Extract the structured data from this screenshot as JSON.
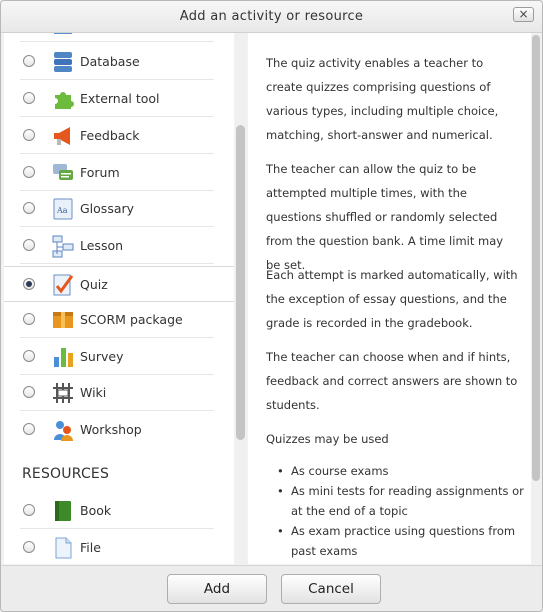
{
  "dialog": {
    "title": "Add an activity or resource",
    "close_glyph": "×"
  },
  "activities": {
    "selected_index": 6,
    "items": [
      {
        "label": "",
        "icon": "partial-icon"
      },
      {
        "label": "Database",
        "icon": "database-icon"
      },
      {
        "label": "External tool",
        "icon": "puzzle-icon"
      },
      {
        "label": "Feedback",
        "icon": "megaphone-icon"
      },
      {
        "label": "Forum",
        "icon": "forum-icon"
      },
      {
        "label": "Glossary",
        "icon": "glossary-icon"
      },
      {
        "label": "Lesson",
        "icon": "lesson-icon"
      },
      {
        "label": "Quiz",
        "icon": "quiz-icon"
      },
      {
        "label": "SCORM package",
        "icon": "scorm-icon"
      },
      {
        "label": "Survey",
        "icon": "survey-icon"
      },
      {
        "label": "Wiki",
        "icon": "wiki-icon"
      },
      {
        "label": "Workshop",
        "icon": "workshop-icon"
      }
    ]
  },
  "resources": {
    "heading": "RESOURCES",
    "items": [
      {
        "label": "Book",
        "icon": "book-icon"
      },
      {
        "label": "File",
        "icon": "file-icon"
      }
    ]
  },
  "description": {
    "paragraphs": [
      "The quiz activity enables a teacher to create quizzes comprising questions of various types, including multiple choice, matching, short-answer and numerical.",
      "The teacher can allow the quiz to be attempted multiple times, with the questions shuffled or randomly selected from the question bank. A time limit may be set.",
      "Each attempt is marked automatically, with the exception of essay questions, and the grade is recorded in the gradebook.",
      "The teacher can choose when and if hints, feedback and correct answers are shown to students.",
      "Quizzes may be used"
    ],
    "bullets": [
      "As course exams",
      "As mini tests for reading assignments or at the end of a topic",
      "As exam practice using questions from past exams"
    ]
  },
  "footer": {
    "add_label": "Add",
    "cancel_label": "Cancel"
  }
}
